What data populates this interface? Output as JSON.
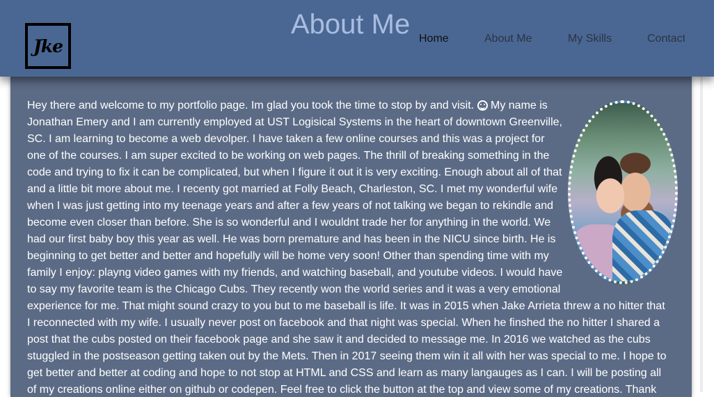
{
  "header": {
    "logo_text": "Jke",
    "title": "About Me",
    "nav": {
      "home": "Home",
      "about": "About Me",
      "skills": "My Skills",
      "contact": "Contact"
    },
    "colors": {
      "header_bg": "#4a6793",
      "title": "#a9bde0",
      "content_bg": "#5c6b85"
    }
  },
  "photo": {
    "alt": "Couple selfie",
    "icon": "photo-oval"
  },
  "bio": {
    "part1": "Hey there and welcome to my portfolio page. Im glad you took the time to stop by and visit.",
    "part2": " My name is Jonathan Emery and I am currently employed at UST Logisical Systems in the heart of downtown Greenville, SC. I am learning to become a web devolper. I have taken a few online courses and this was a project for one of the courses. I am super excited to be working on web pages. The thrill of breaking something in the code and trying to fix it can be complicated, but when I figure it out it is very exciting. Enough about all of that and a little bit more about me. I recenty got married at Folly Beach, Charleston, SC. I met my wonderful wife when I was just getting into my teenage years and after a few years of not talking we began to rekindle and become even closer than before. She is so wonderful and I wouldnt trade her for anything in the world. We had our first baby boy this year as well. He was born premature and has been in the NICU since birth. He is beginning to get better and better and hopefully will be home very soon! Other than spending time with my family I enjoy: playng video games with my friends, and watching baseball, and youtube videos. I would have to say my favorite team is the Chicago Cubs. They recently won the world series and it was a very emotional experience for me. That might sound crazy to you but to me baseball is life. It was in 2015 when Jake Arrieta threw a no hitter that I reconnected with my wife. I usually never post on facebook and that night was special. When he finshed the no hitter I shared a post that the cubs posted on their facebook page and she saw it and decided to message me. In 2016 we watched as the cubs stuggled in the postseason getting taken out by the Mets. Then in 2017 seeing them win it all with her was special to me. I hope to get better and better at coding and hope to not stop at HTML and CSS and learn as many langauges as I can. I will be posting all of my creations online either on github or codepen. Feel free to click the button at the top and view some of my creations. Thank you!",
    "emoji_icon": "smiley-icon"
  }
}
